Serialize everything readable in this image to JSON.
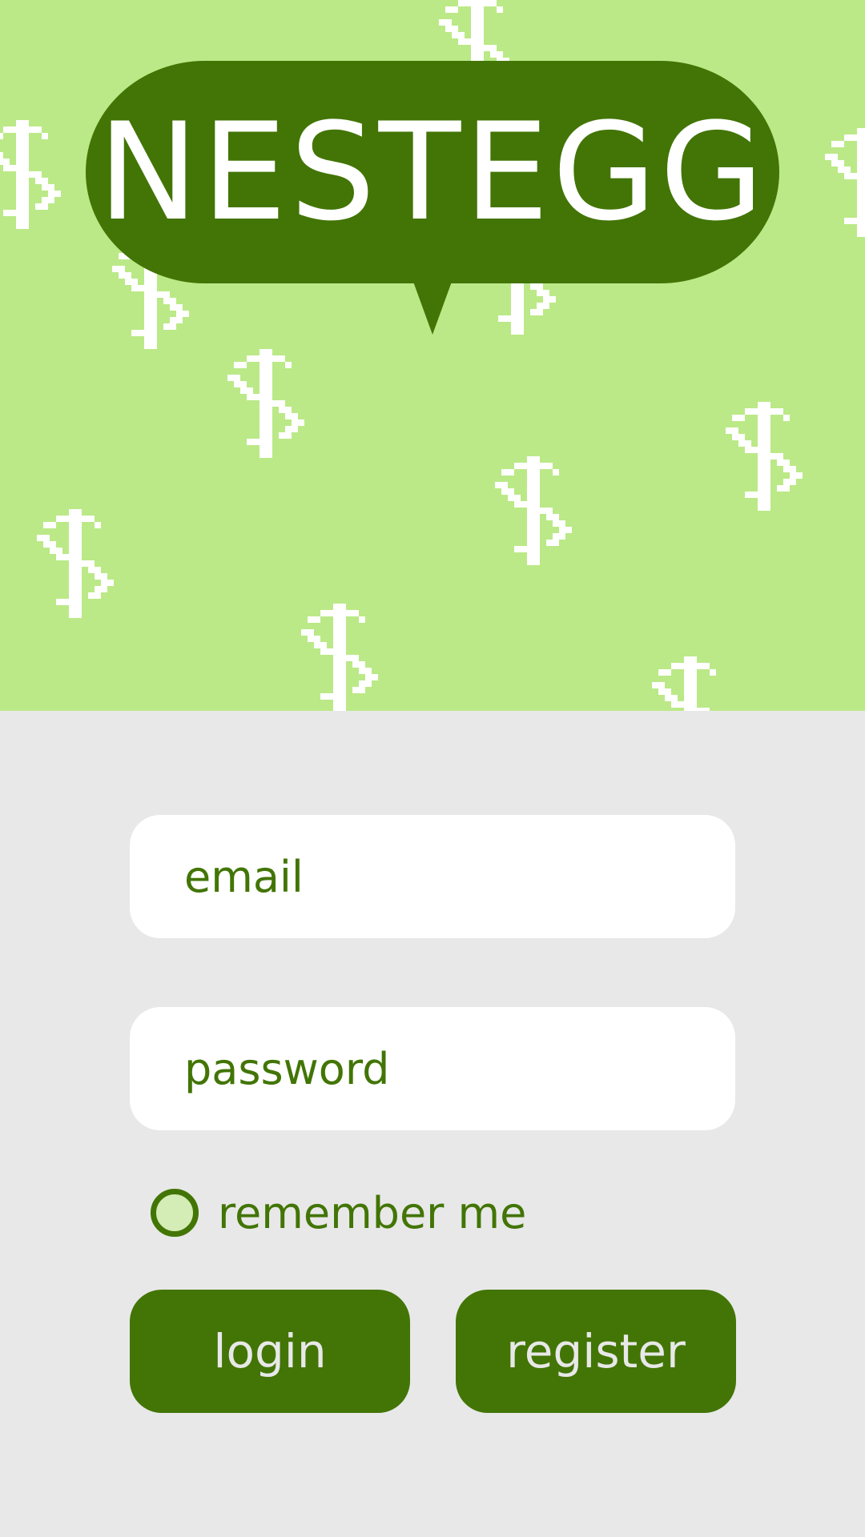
{
  "app": {
    "logo_text": "NESTEGG",
    "colors": {
      "hero_background": "#bbe987",
      "brand_green": "#427505",
      "page_background": "#e8e8e8",
      "field_background": "#ffffff"
    }
  },
  "form": {
    "email_placeholder": "email",
    "password_placeholder": "password",
    "remember_label": "remember me",
    "remember_checked": false,
    "login_label": "login",
    "register_label": "register"
  },
  "decor": {
    "pattern_icon": "pixel-dollar-icon"
  }
}
